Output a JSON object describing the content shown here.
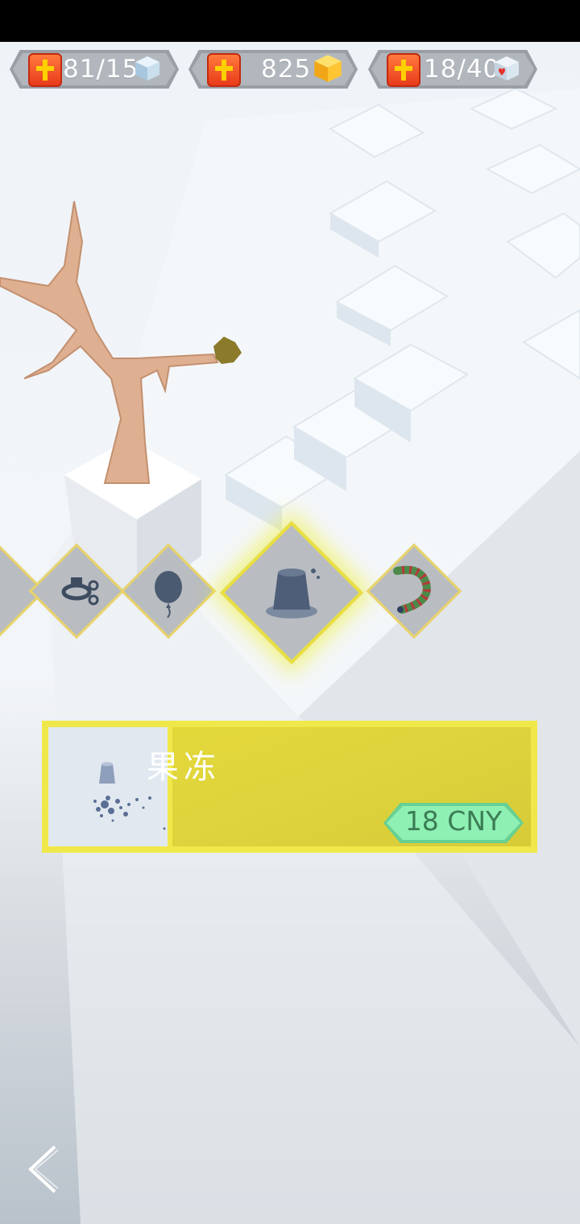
{
  "hud": {
    "keys": {
      "value": "81/15",
      "icon": "ice-cube-icon",
      "add_icon": "plus-icon"
    },
    "gems": {
      "value": "825",
      "icon": "gold-gem-icon",
      "add_icon": "plus-icon"
    },
    "hearts": {
      "value": "18/40",
      "icon": "heart-cube-icon",
      "add_icon": "plus-icon"
    }
  },
  "shop": {
    "items": [
      {
        "icon": "partial-item-icon"
      },
      {
        "icon": "hook-item-icon"
      },
      {
        "icon": "balloon-icon"
      },
      {
        "icon": "jelly-icon",
        "selected": true
      },
      {
        "icon": "snake-icon"
      }
    ]
  },
  "selected_item": {
    "name": "果冻",
    "price": "18 CNY",
    "preview_icon": "jelly-preview-icon"
  },
  "nav": {
    "back_icon": "chevron-left-icon"
  },
  "colors": {
    "accent": "#e9df40",
    "price": "#8ff0b3",
    "plus": "#e83a1a"
  }
}
